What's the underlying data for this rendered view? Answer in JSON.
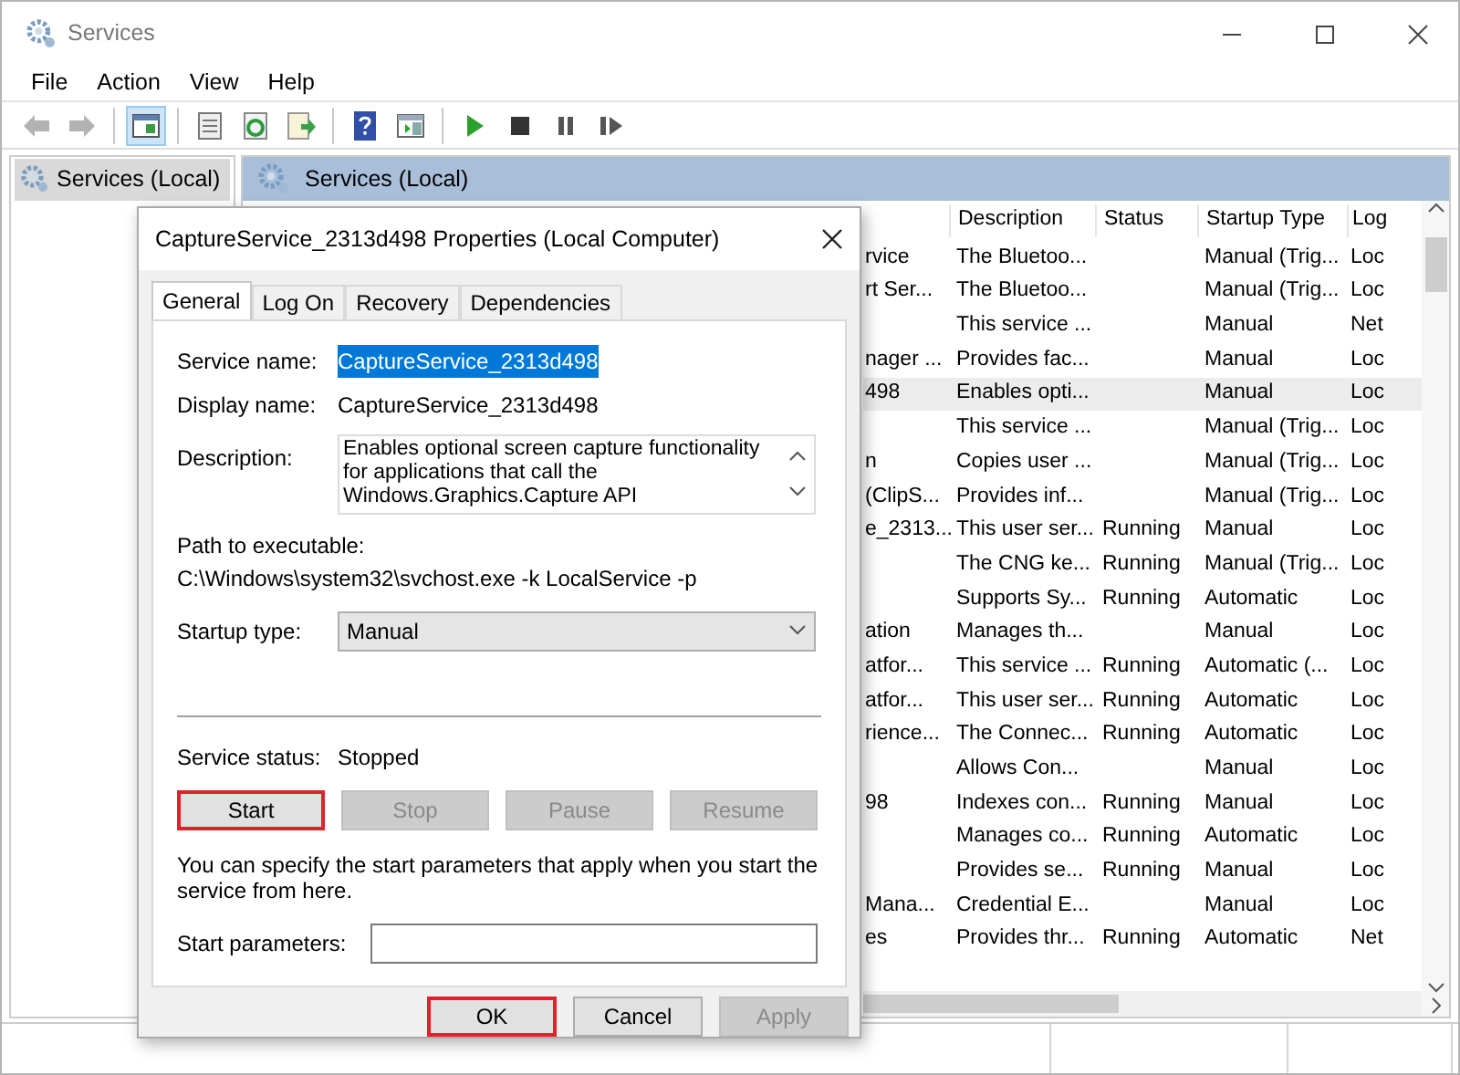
{
  "window": {
    "title": "Services"
  },
  "menu": [
    "File",
    "Action",
    "View",
    "Help"
  ],
  "toolbar": [
    {
      "kind": "back",
      "disabled": true,
      "pressed": false
    },
    {
      "kind": "forward",
      "disabled": true,
      "pressed": false
    },
    {
      "kind": "sep"
    },
    {
      "kind": "tree",
      "disabled": false,
      "pressed": true
    },
    {
      "kind": "sep"
    },
    {
      "kind": "properties",
      "disabled": false,
      "pressed": false
    },
    {
      "kind": "refresh",
      "disabled": false,
      "pressed": false
    },
    {
      "kind": "export",
      "disabled": false,
      "pressed": false
    },
    {
      "kind": "sep"
    },
    {
      "kind": "help",
      "disabled": false,
      "pressed": false
    },
    {
      "kind": "pane",
      "disabled": false,
      "pressed": false
    },
    {
      "kind": "sep"
    },
    {
      "kind": "play",
      "disabled": false,
      "pressed": false
    },
    {
      "kind": "stop",
      "disabled": false,
      "pressed": false
    },
    {
      "kind": "pause",
      "disabled": false,
      "pressed": false
    },
    {
      "kind": "resume",
      "disabled": false,
      "pressed": false
    }
  ],
  "tree": [
    {
      "label": "Services (Local)",
      "selected": true
    }
  ],
  "pane_header": "Services (Local)",
  "table": {
    "columns": [
      "Description",
      "Status",
      "Startup Type",
      "Log"
    ],
    "rows": [
      {
        "name": "rvice",
        "description": "The Bluetoo...",
        "status": "",
        "startup": "Manual (Trig...",
        "logon": "Loc",
        "selected": false
      },
      {
        "name": "rt Ser...",
        "description": "The Bluetoo...",
        "status": "",
        "startup": "Manual (Trig...",
        "logon": "Loc",
        "selected": false
      },
      {
        "name": "",
        "description": "This service ...",
        "status": "",
        "startup": "Manual",
        "logon": "Net",
        "selected": false
      },
      {
        "name": "nager ...",
        "description": "Provides fac...",
        "status": "",
        "startup": "Manual",
        "logon": "Loc",
        "selected": false
      },
      {
        "name": "498",
        "description": "Enables opti...",
        "status": "",
        "startup": "Manual",
        "logon": "Loc",
        "selected": true
      },
      {
        "name": "",
        "description": "This service ...",
        "status": "",
        "startup": "Manual (Trig...",
        "logon": "Loc",
        "selected": false
      },
      {
        "name": "n",
        "description": "Copies user ...",
        "status": "",
        "startup": "Manual (Trig...",
        "logon": "Loc",
        "selected": false
      },
      {
        "name": "(ClipS...",
        "description": "Provides inf...",
        "status": "",
        "startup": "Manual (Trig...",
        "logon": "Loc",
        "selected": false
      },
      {
        "name": "e_2313...",
        "description": "This user ser...",
        "status": "Running",
        "startup": "Manual",
        "logon": "Loc",
        "selected": false
      },
      {
        "name": "",
        "description": "The CNG ke...",
        "status": "Running",
        "startup": "Manual (Trig...",
        "logon": "Loc",
        "selected": false
      },
      {
        "name": "",
        "description": "Supports Sy...",
        "status": "Running",
        "startup": "Automatic",
        "logon": "Loc",
        "selected": false
      },
      {
        "name": "ation",
        "description": "Manages th...",
        "status": "",
        "startup": "Manual",
        "logon": "Loc",
        "selected": false
      },
      {
        "name": "atfor...",
        "description": "This service ...",
        "status": "Running",
        "startup": "Automatic (...",
        "logon": "Loc",
        "selected": false
      },
      {
        "name": "atfor...",
        "description": "This user ser...",
        "status": "Running",
        "startup": "Automatic",
        "logon": "Loc",
        "selected": false
      },
      {
        "name": "rience...",
        "description": "The Connec...",
        "status": "Running",
        "startup": "Automatic",
        "logon": "Loc",
        "selected": false
      },
      {
        "name": "",
        "description": "Allows Con...",
        "status": "",
        "startup": "Manual",
        "logon": "Loc",
        "selected": false
      },
      {
        "name": "98",
        "description": "Indexes con...",
        "status": "Running",
        "startup": "Manual",
        "logon": "Loc",
        "selected": false
      },
      {
        "name": "",
        "description": "Manages co...",
        "status": "Running",
        "startup": "Automatic",
        "logon": "Loc",
        "selected": false
      },
      {
        "name": "",
        "description": "Provides se...",
        "status": "Running",
        "startup": "Manual",
        "logon": "Loc",
        "selected": false
      },
      {
        "name": "Mana...",
        "description": "Credential E...",
        "status": "",
        "startup": "Manual",
        "logon": "Loc",
        "selected": false
      },
      {
        "name": "es",
        "description": "Provides thr...",
        "status": "Running",
        "startup": "Automatic",
        "logon": "Net",
        "selected": false
      }
    ]
  },
  "dialog": {
    "title": "CaptureService_2313d498 Properties (Local Computer)",
    "tabs": [
      {
        "label": "General",
        "selected": true
      },
      {
        "label": "Log On",
        "selected": false
      },
      {
        "label": "Recovery",
        "selected": false
      },
      {
        "label": "Dependencies",
        "selected": false
      }
    ],
    "service_name": {
      "label": "Service name:",
      "value": "CaptureService_2313d498",
      "selected": true
    },
    "display_name": {
      "label": "Display name:",
      "value": "CaptureService_2313d498"
    },
    "description": {
      "label": "Description:",
      "value": "Enables optional screen capture functionality for applications that call the Windows.Graphics.Capture API"
    },
    "path": {
      "label": "Path to executable:",
      "value": "C:\\Windows\\system32\\svchost.exe -k LocalService -p"
    },
    "startup_type": {
      "label": "Startup type:",
      "value": "Manual"
    },
    "service_status": {
      "label": "Service status:",
      "value": "Stopped"
    },
    "control_buttons": [
      {
        "label": "Start",
        "disabled": false,
        "highlighted": true
      },
      {
        "label": "Stop",
        "disabled": true,
        "highlighted": false
      },
      {
        "label": "Pause",
        "disabled": true,
        "highlighted": false
      },
      {
        "label": "Resume",
        "disabled": true,
        "highlighted": false
      }
    ],
    "note": "You can specify the start parameters that apply when you start the service from here.",
    "start_parameters": {
      "label": "Start parameters:"
    },
    "buttons": [
      {
        "label": "OK",
        "disabled": false,
        "highlighted": true
      },
      {
        "label": "Cancel",
        "disabled": false,
        "highlighted": false
      },
      {
        "label": "Apply",
        "disabled": true,
        "highlighted": false
      }
    ]
  }
}
